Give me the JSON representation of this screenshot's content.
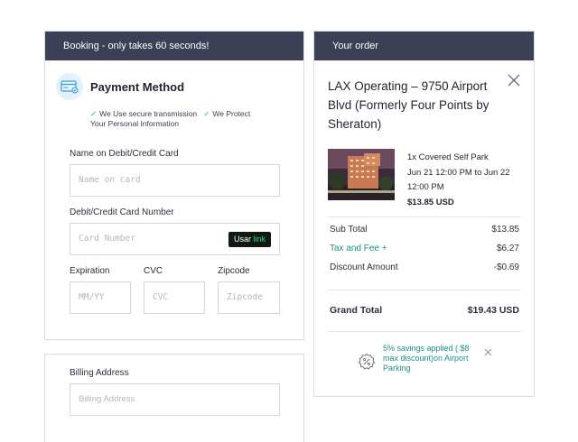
{
  "booking": {
    "header": "Booking - only takes 60 seconds!",
    "payment_title": "Payment Method",
    "secure_1": "We Use secure transmission",
    "secure_2": "We Protect",
    "secure_3": "Your Personal Information",
    "name_label": "Name on Debit/Credit Card",
    "name_placeholder": "Name on card",
    "card_label": "Debit/Credit Card Number",
    "card_placeholder": "Card Number",
    "usar_text": "Usar",
    "usar_link": "link",
    "expiration_label": "Expiration",
    "expiration_placeholder": "MM/YY",
    "cvc_label": "CVC",
    "cvc_placeholder": "CVC",
    "zipcode_label": "Zipcode",
    "zipcode_placeholder": "Zipcode"
  },
  "billing": {
    "label": "Billing Address",
    "placeholder": "Billing Address"
  },
  "order": {
    "header": "Your order",
    "title": "LAX Operating – 9750 Airport Blvd (Formerly Four Points by Sheraton)",
    "detail_line1": "1x Covered Self Park",
    "detail_line2": "Jun 21 12:00 PM to Jun 22 12:00 PM",
    "detail_price": "$13.85 USD",
    "subtotal_label": "Sub Total",
    "subtotal_value": "$13.85",
    "tax_label": "Tax and Fee +",
    "tax_value": "$6.27",
    "discount_label": "Discount Amount",
    "discount_value": "-$0.69",
    "grand_label": "Grand Total",
    "grand_value": "$19.43 USD",
    "promo_text": "5% savings applied ( $8 max discount)on Airport Parking"
  },
  "colors": {
    "header_bg": "#3b4057",
    "accent_teal": "#18908a",
    "check_blue": "#2b9fd6"
  },
  "icons": [
    "card-icon",
    "check-icon",
    "close-icon",
    "discount-icon"
  ]
}
